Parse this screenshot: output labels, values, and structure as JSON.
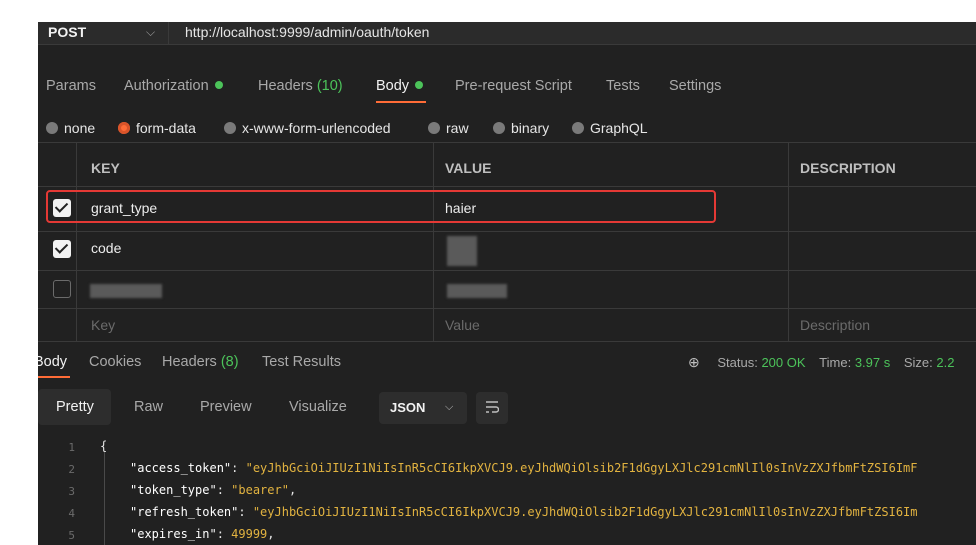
{
  "request": {
    "method": "POST",
    "url": "http://localhost:9999/admin/oauth/token"
  },
  "request_tabs": [
    {
      "label": "Params"
    },
    {
      "label": "Authorization"
    },
    {
      "label": "Headers",
      "count": "(10)"
    },
    {
      "label": "Body"
    },
    {
      "label": "Pre-request Script"
    },
    {
      "label": "Tests"
    },
    {
      "label": "Settings"
    }
  ],
  "body_types": [
    "none",
    "form-data",
    "x-www-form-urlencoded",
    "raw",
    "binary",
    "GraphQL"
  ],
  "body_type_selected": "form-data",
  "table": {
    "headers": {
      "key": "KEY",
      "value": "VALUE",
      "description": "DESCRIPTION"
    },
    "rows": [
      {
        "key": "grant_type",
        "value": "haier",
        "checked": true
      },
      {
        "key": "code",
        "value": "",
        "checked": true
      },
      {
        "key": "",
        "value": "",
        "checked": false
      }
    ],
    "placeholders": {
      "key": "Key",
      "value": "Value",
      "description": "Description"
    }
  },
  "response_tabs": [
    {
      "label": "Body"
    },
    {
      "label": "Cookies"
    },
    {
      "label": "Headers",
      "count": "(8)"
    },
    {
      "label": "Test Results"
    }
  ],
  "status": {
    "status_label": "Status:",
    "status_value": "200 OK",
    "time_label": "Time:",
    "time_value": "3.97 s",
    "size_label": "Size:",
    "size_value": "2.2"
  },
  "view_tabs": [
    "Pretty",
    "Raw",
    "Preview",
    "Visualize"
  ],
  "format": "JSON",
  "code_lines": [
    {
      "n": "1",
      "text": "{"
    },
    {
      "n": "2",
      "key": "\"access_token\"",
      "sep": ": ",
      "val": "\"eyJhbGciOiJIUzI1NiIsInR5cCI6IkpXVCJ9.eyJhdWQiOlsib2F1dGgyLXJlc291cmNlIl0sInVzZXJfbmFtZSI6ImF"
    },
    {
      "n": "3",
      "key": "\"token_type\"",
      "sep": ": ",
      "val": "\"bearer\"",
      "tail": ","
    },
    {
      "n": "4",
      "key": "\"refresh_token\"",
      "sep": ": ",
      "val": "\"eyJhbGciOiJIUzI1NiIsInR5cCI6IkpXVCJ9.eyJhdWQiOlsib2F1dGgyLXJlc291cmNlIl0sInVzZXJfbmFtZSI6Im"
    },
    {
      "n": "5",
      "key": "\"expires_in\"",
      "sep": ": ",
      "val": "49999",
      "tail": ","
    }
  ],
  "colors": {
    "accent": "#ff6c37",
    "success": "#4cc35a",
    "highlight": "#e53935"
  }
}
